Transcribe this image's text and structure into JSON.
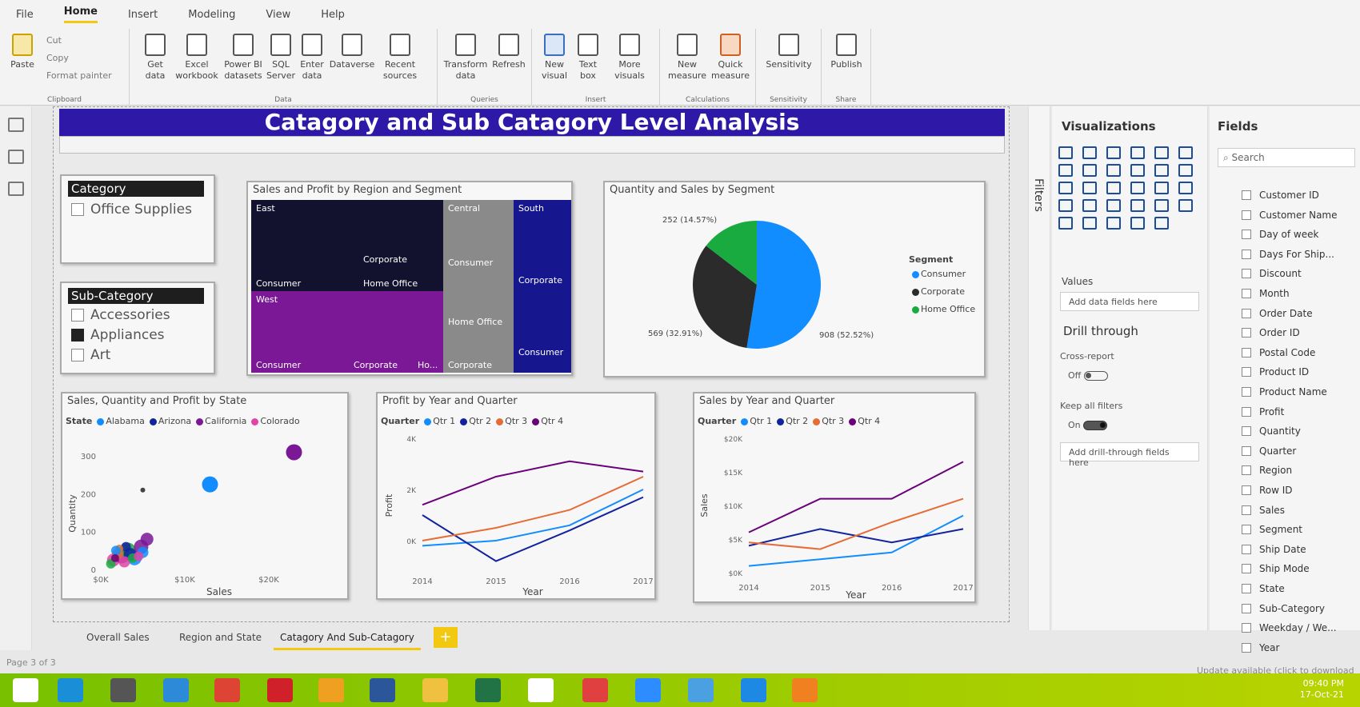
{
  "menu": [
    "File",
    "Home",
    "Insert",
    "Modeling",
    "View",
    "Help"
  ],
  "ribbon": {
    "paste": "Paste",
    "cut": "Cut",
    "copy": "Copy",
    "format_painter": "Format painter",
    "clipboard": "Clipboard",
    "get_data": "Get\ndata",
    "excel": "Excel\nworkbook",
    "pbi": "Power BI\ndatasets",
    "sql": "SQL\nServer",
    "enter": "Enter\ndata",
    "dataverse": "Dataverse",
    "recent": "Recent\nsources",
    "data": "Data",
    "transform": "Transform\ndata",
    "refresh": "Refresh",
    "queries": "Queries",
    "new_visual": "New\nvisual",
    "text_box": "Text\nbox",
    "more_visuals": "More\nvisuals",
    "insert": "Insert",
    "new_measure": "New\nmeasure",
    "quick_measure": "Quick\nmeasure",
    "calculations": "Calculations",
    "sensitivity": "Sensitivity",
    "sensitivity_grp": "Sensitivity",
    "publish": "Publish",
    "share": "Share"
  },
  "report_title": "Catagory and Sub Catagory Level Analysis",
  "slicer_category": {
    "header": "Category",
    "items": [
      {
        "label": "Office Supplies",
        "checked": false
      }
    ]
  },
  "slicer_subcategory": {
    "header": "Sub-Category",
    "items": [
      {
        "label": "Accessories",
        "checked": false
      },
      {
        "label": "Appliances",
        "checked": true
      },
      {
        "label": "Art",
        "checked": false
      }
    ]
  },
  "treemap": {
    "title": "Sales and Profit by Region and Segment",
    "labels": {
      "east": "East",
      "central": "Central",
      "south": "South",
      "west": "West",
      "corporate": "Corporate",
      "consumer": "Consumer",
      "home_office": "Home Office",
      "ho": "Ho..."
    }
  },
  "pie": {
    "title": "Quantity and Sales by Segment",
    "legend_title": "Segment",
    "labels": {
      "green": "252 (14.57%)",
      "dark": "569 (32.91%)",
      "blue": "908 (52.52%)"
    }
  },
  "scatter": {
    "title": "Sales, Quantity and Profit by State",
    "legend_title": "State",
    "ylabel": "Quantity",
    "xlabel": "Sales"
  },
  "profit_line": {
    "title": "Profit by Year and Quarter",
    "legend_title": "Quarter",
    "ylabel": "Profit",
    "xlabel": "Year"
  },
  "sales_line": {
    "title": "Sales by Year and Quarter",
    "legend_title": "Quarter",
    "ylabel": "Sales",
    "xlabel": "Year"
  },
  "viz_pane": {
    "title": "Visualizations",
    "values": "Values",
    "add_fields": "Add data fields here",
    "drill": "Drill through",
    "cross": "Cross-report",
    "off": "Off",
    "keep": "Keep all filters",
    "on": "On",
    "add_drill": "Add drill-through fields here"
  },
  "fields_pane": {
    "title": "Fields",
    "search_placeholder": "Search",
    "items": [
      "Customer ID",
      "Customer Name",
      "Day of week",
      "Days For Ship...",
      "Discount",
      "Month",
      "Order Date",
      "Order ID",
      "Postal Code",
      "Product ID",
      "Product Name",
      "Profit",
      "Quantity",
      "Quarter",
      "Region",
      "Row ID",
      "Sales",
      "Segment",
      "Ship Date",
      "Ship Mode",
      "State",
      "Sub-Category",
      "Weekday / We...",
      "Year"
    ]
  },
  "filters_label": "Filters",
  "tabs": [
    "Overall Sales",
    "Region and State",
    "Catagory And Sub-Catagory"
  ],
  "page_info": "Page 3 of 3",
  "update_text": "Update available (click to download",
  "clock": {
    "time": "09:40 PM",
    "date": "17-Oct-21"
  },
  "chart_data": [
    {
      "type": "pie",
      "title": "Quantity and Sales by Segment",
      "legend": [
        "Consumer",
        "Corporate",
        "Home Office"
      ],
      "values": [
        908,
        569,
        252
      ],
      "labels": [
        "908 (52.52%)",
        "569 (32.91%)",
        "252 (14.57%)"
      ],
      "colors": [
        "#118dff",
        "#2b2b2b",
        "#1aab40"
      ]
    },
    {
      "type": "scatter",
      "title": "Sales, Quantity and Profit by State",
      "xlabel": "Sales",
      "ylabel": "Quantity",
      "legend": [
        "Alabama",
        "Arizona",
        "California",
        "Colorado"
      ],
      "x_ticks": [
        "$0K",
        "$10K",
        "$20K"
      ],
      "y_ticks": [
        "0",
        "100",
        "200",
        "300"
      ],
      "xlim": [
        0,
        24000
      ],
      "ylim": [
        0,
        330
      ]
    },
    {
      "type": "line",
      "title": "Profit by Year and Quarter",
      "xlabel": "Year",
      "ylabel": "Profit",
      "x": [
        "2014",
        "2015",
        "2016",
        "2017"
      ],
      "y_ticks": [
        "0K",
        "2K",
        "4K"
      ],
      "ylim": [
        -1000,
        4000
      ],
      "legend": [
        "Qtr 1",
        "Qtr 2",
        "Qtr 3",
        "Qtr 4"
      ],
      "series": [
        {
          "name": "Qtr 1",
          "values": [
            -200,
            0,
            600,
            2000
          ]
        },
        {
          "name": "Qtr 2",
          "values": [
            1000,
            -800,
            400,
            1700
          ]
        },
        {
          "name": "Qtr 3",
          "values": [
            0,
            500,
            1200,
            2500
          ]
        },
        {
          "name": "Qtr 4",
          "values": [
            1400,
            2500,
            3100,
            2700
          ]
        }
      ]
    },
    {
      "type": "line",
      "title": "Sales by Year and Quarter",
      "xlabel": "Year",
      "ylabel": "Sales",
      "x": [
        "2014",
        "2015",
        "2016",
        "2017"
      ],
      "y_ticks": [
        "$0K",
        "$5K",
        "$10K",
        "$15K",
        "$20K"
      ],
      "ylim": [
        0,
        20000
      ],
      "legend": [
        "Qtr 1",
        "Qtr 2",
        "Qtr 3",
        "Qtr 4"
      ],
      "series": [
        {
          "name": "Qtr 1",
          "values": [
            1000,
            2000,
            3000,
            8500
          ]
        },
        {
          "name": "Qtr 2",
          "values": [
            4000,
            6500,
            4500,
            6500
          ]
        },
        {
          "name": "Qtr 3",
          "values": [
            4500,
            3500,
            7500,
            11000
          ]
        },
        {
          "name": "Qtr 4",
          "values": [
            6000,
            11000,
            11000,
            16500
          ]
        }
      ]
    }
  ],
  "colors": {
    "title_bg": "#2d18a8",
    "qtr1": "#118dff",
    "qtr2": "#12239e",
    "qtr3": "#e66c37",
    "qtr4": "#6b007b"
  }
}
